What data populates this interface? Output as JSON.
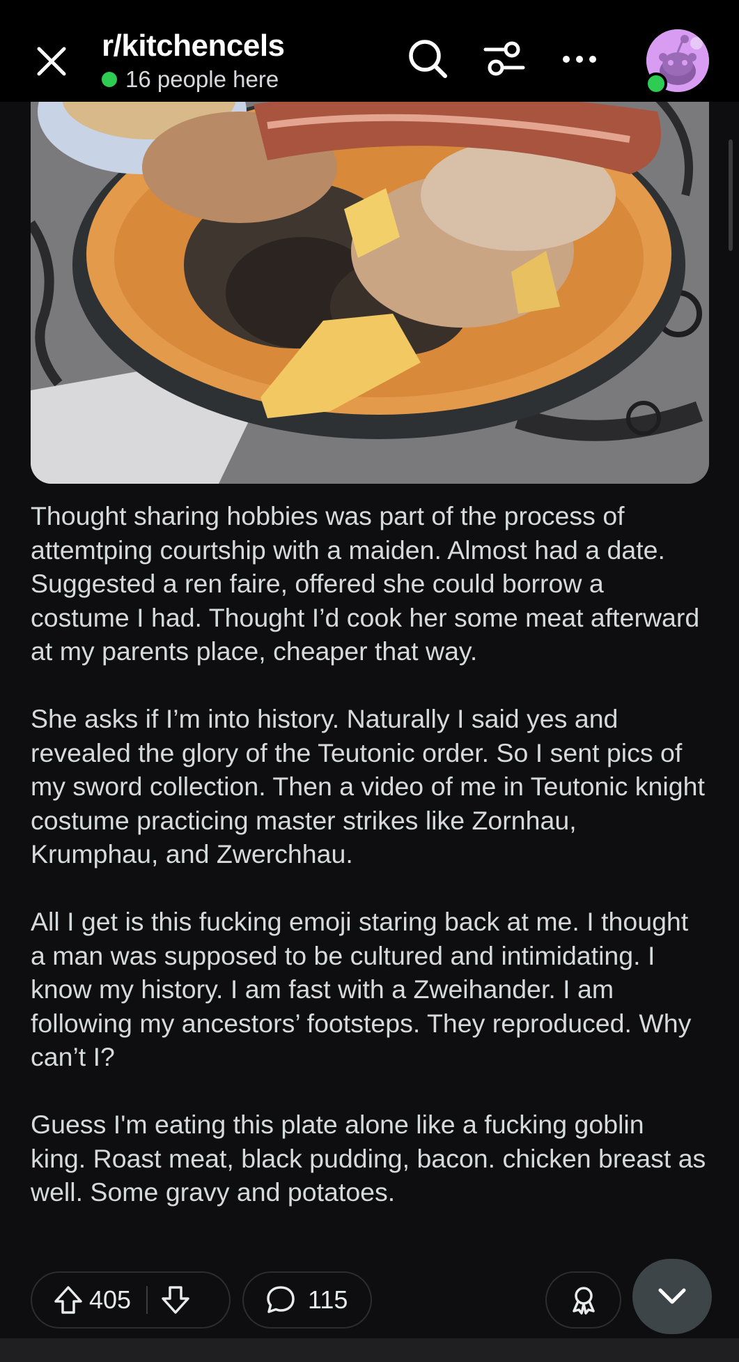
{
  "header": {
    "subreddit": "r/kitchencels",
    "online_text": "16 people here",
    "close_icon": "close-icon",
    "search_icon": "search-icon",
    "filter_icon": "filter-icon",
    "more_icon": "more-horizontal-icon"
  },
  "post": {
    "image_description_icon": "food-plate-image",
    "paragraphs": [
      "Thought sharing hobbies was part of the process of attemtping courtship with a maiden. Almost had a date. Suggested a ren faire, offered she could borrow a costume I had. Thought I’d cook her some meat afterward at my parents place, cheaper that way.",
      "She asks if I’m into history. Naturally I said yes and revealed the glory of the Teutonic order. So I sent pics of my sword collection. Then a video of me in Teutonic knight costume practicing master strikes like Zornhau, Krumphau, and Zwerchhau.",
      "All I get is this fucking emoji staring back at me. I thought a man was supposed to be cultured and intimidating. I know my history. I am fast with a Zweihander. I am following my ancestors’ footsteps. They reproduced. Why can’t I?",
      "Guess I'm eating this plate alone like a fucking goblin king. Roast meat, black pudding, bacon. chicken breast as well. Some gravy and potatoes."
    ]
  },
  "actions": {
    "upvotes": "405",
    "comments": "115"
  },
  "colors": {
    "background": "#0e0e10",
    "topbar": "#000000",
    "online_green": "#2ecc52",
    "avatar_purple": "#d89cf2"
  }
}
